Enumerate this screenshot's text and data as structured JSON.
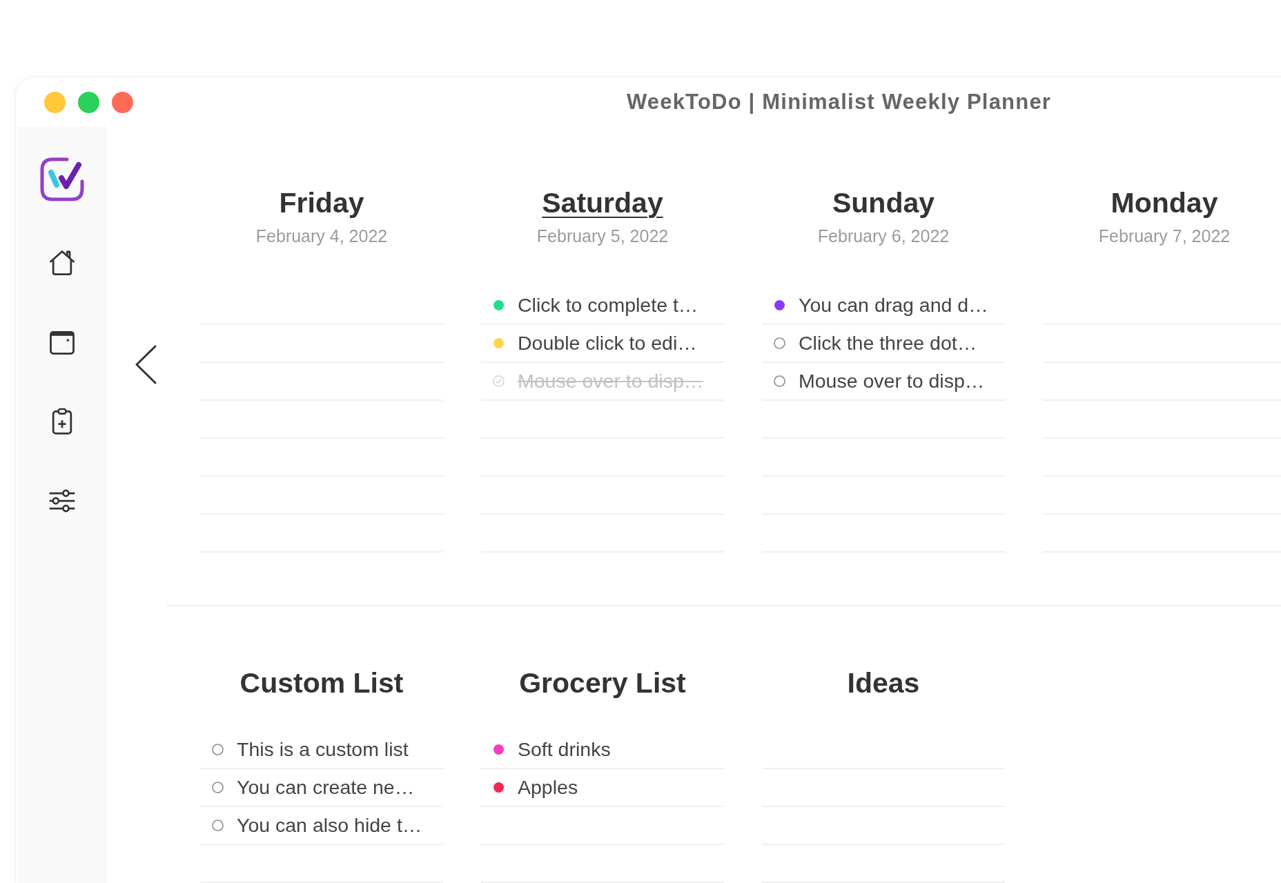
{
  "window": {
    "title": "WeekToDo | Minimalist Weekly Planner"
  },
  "days": [
    {
      "name": "Friday",
      "date": "February 4, 2022",
      "today": false
    },
    {
      "name": "Saturday",
      "date": "February 5, 2022",
      "today": true,
      "tasks": [
        {
          "text": "Click to complete t…",
          "done": false,
          "color": "#1fdf8a"
        },
        {
          "text": "Double click to edi…",
          "done": false,
          "color": "#fbd54b"
        },
        {
          "text": "Mouse over to disp…",
          "done": true
        }
      ]
    },
    {
      "name": "Sunday",
      "date": "February 6, 2022",
      "today": false,
      "tasks": [
        {
          "text": "You can drag and d…",
          "done": false,
          "color": "#8a3cf5"
        },
        {
          "text": "Click the three dot…",
          "done": false
        },
        {
          "text": "Mouse over to disp…",
          "done": false
        }
      ]
    },
    {
      "name": "Monday",
      "date": "February 7, 2022",
      "today": false
    }
  ],
  "lists": [
    {
      "title": "Custom List",
      "tasks": [
        {
          "text": "This is a custom list",
          "done": false
        },
        {
          "text": "You can create ne…",
          "done": false
        },
        {
          "text": "You can also hide t…",
          "done": false
        }
      ]
    },
    {
      "title": "Grocery List",
      "tasks": [
        {
          "text": "Soft drinks",
          "done": false,
          "color": "#f43dbf"
        },
        {
          "text": "Apples",
          "done": false,
          "color": "#f5284c"
        }
      ]
    },
    {
      "title": "Ideas"
    }
  ]
}
